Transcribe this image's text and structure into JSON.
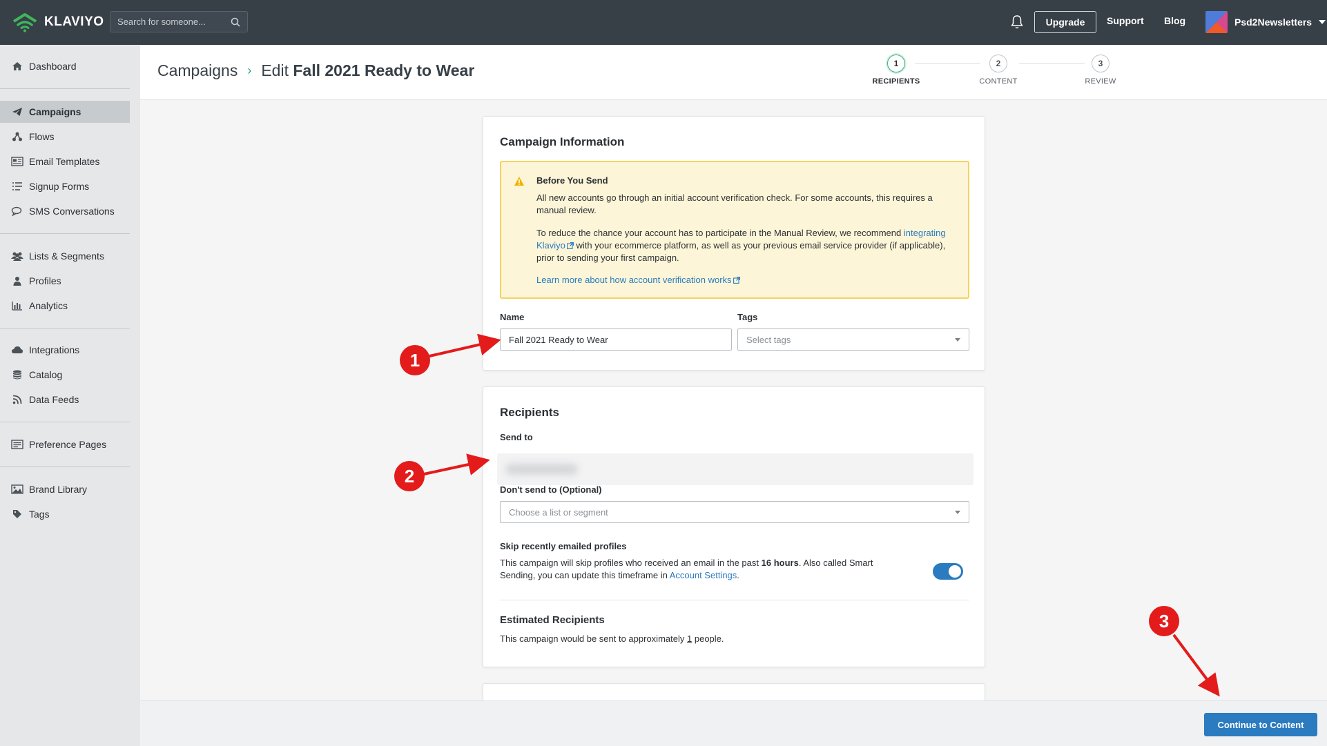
{
  "topbar": {
    "logo_text": "KLAVIYO",
    "search_placeholder": "Search for someone...",
    "upgrade_label": "Upgrade",
    "support_label": "Support",
    "blog_label": "Blog",
    "account_name": "Psd2Newsletters"
  },
  "sidebar": {
    "items": [
      {
        "label": "Dashboard",
        "icon": "home-icon"
      },
      {
        "label": "Campaigns",
        "icon": "paper-plane-icon",
        "active": true
      },
      {
        "label": "Flows",
        "icon": "flow-icon"
      },
      {
        "label": "Email Templates",
        "icon": "template-icon"
      },
      {
        "label": "Signup Forms",
        "icon": "form-icon"
      },
      {
        "label": "SMS Conversations",
        "icon": "chat-icon"
      },
      {
        "label": "Lists & Segments",
        "icon": "users-icon"
      },
      {
        "label": "Profiles",
        "icon": "user-icon"
      },
      {
        "label": "Analytics",
        "icon": "bar-chart-icon"
      },
      {
        "label": "Integrations",
        "icon": "cloud-icon"
      },
      {
        "label": "Catalog",
        "icon": "database-icon"
      },
      {
        "label": "Data Feeds",
        "icon": "rss-icon"
      },
      {
        "label": "Preference Pages",
        "icon": "preference-icon"
      },
      {
        "label": "Brand Library",
        "icon": "image-icon"
      },
      {
        "label": "Tags",
        "icon": "tag-icon"
      }
    ]
  },
  "header": {
    "crumb_root": "Campaigns",
    "crumb_prefix": "Edit",
    "crumb_title": "Fall 2021 Ready to Wear",
    "steps": [
      {
        "num": "1",
        "label": "RECIPIENTS",
        "active": true
      },
      {
        "num": "2",
        "label": "CONTENT"
      },
      {
        "num": "3",
        "label": "REVIEW"
      }
    ]
  },
  "campaign_info": {
    "title": "Campaign Information",
    "notice_title": "Before You Send",
    "notice_p1": "All new accounts go through an initial account verification check. For some accounts, this requires a manual review.",
    "notice_p2_before": "To reduce the chance your account has to participate in the Manual Review, we recommend",
    "notice_p2_link": "integrating Klaviyo",
    "notice_p2_after": "with your ecommerce platform, as well as your previous email service provider (if applicable), prior to sending your first campaign.",
    "notice_learn_link": "Learn more about how account verification works",
    "name_label": "Name",
    "name_value": "Fall 2021 Ready to Wear",
    "tags_label": "Tags",
    "tags_placeholder": "Select tags"
  },
  "recipients": {
    "title": "Recipients",
    "send_to_label": "Send to",
    "dont_send_label": "Don't send to (Optional)",
    "dont_send_placeholder": "Choose a list or segment",
    "skip_label": "Skip recently emailed profiles",
    "skip_text_1": "This campaign will skip profiles who received an email in the past",
    "skip_hours": "16 hours",
    "skip_text_2": ". Also called Smart Sending, you can update this timeframe in",
    "skip_link": "Account Settings",
    "skip_text_3": ".",
    "smart_sending_on": true,
    "estimated_title": "Estimated Recipients",
    "estimated_text_1": "This campaign would be sent to approximately",
    "estimated_count": "1",
    "estimated_text_2": "people."
  },
  "footer": {
    "continue_label": "Continue to Content"
  },
  "annotations": [
    "1",
    "2",
    "3"
  ],
  "colors": {
    "topbar": "#373f47",
    "primary_button": "#2a7bbf",
    "annotation_red": "#e31b1b",
    "notice_bg": "#fdf5d7",
    "notice_border": "#f2d35f"
  }
}
